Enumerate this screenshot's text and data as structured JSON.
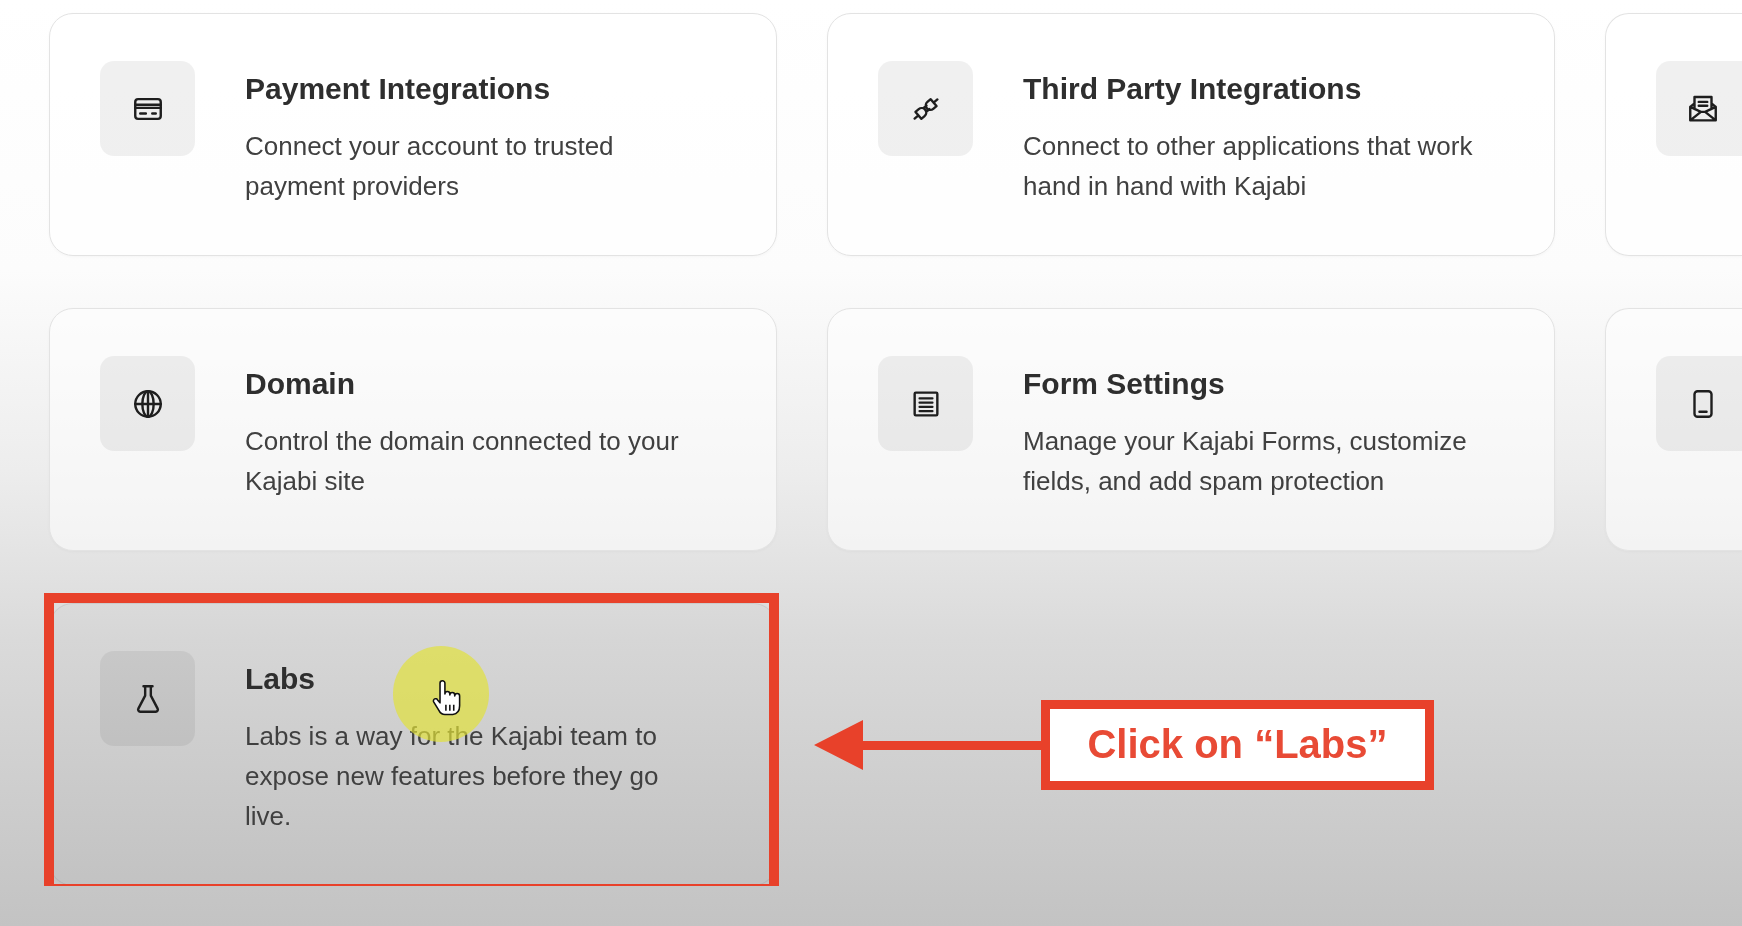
{
  "cards": [
    {
      "kind": "full",
      "title": "Payment Integrations",
      "description": "Connect your account to trusted payment providers",
      "hovered": false,
      "highlighted": false
    },
    {
      "kind": "full",
      "title": "Third Party Integrations",
      "description": "Connect to other applications that work hand in hand with Kajabi",
      "hovered": false,
      "highlighted": false
    },
    {
      "kind": "cut"
    },
    {
      "kind": "full",
      "title": "Domain",
      "description": "Control the domain connected to your Kajabi site",
      "hovered": false,
      "highlighted": false
    },
    {
      "kind": "full",
      "title": "Form Settings",
      "description": "Manage your Kajabi Forms, customize fields, and add spam protection",
      "hovered": false,
      "highlighted": false
    },
    {
      "kind": "cut"
    },
    {
      "kind": "full",
      "title": "Labs",
      "description": "Labs is a way for the Kajabi team to expose new features before they go live.",
      "hovered": true,
      "highlighted": true
    }
  ],
  "callout": {
    "text": "Click on “Labs”"
  }
}
